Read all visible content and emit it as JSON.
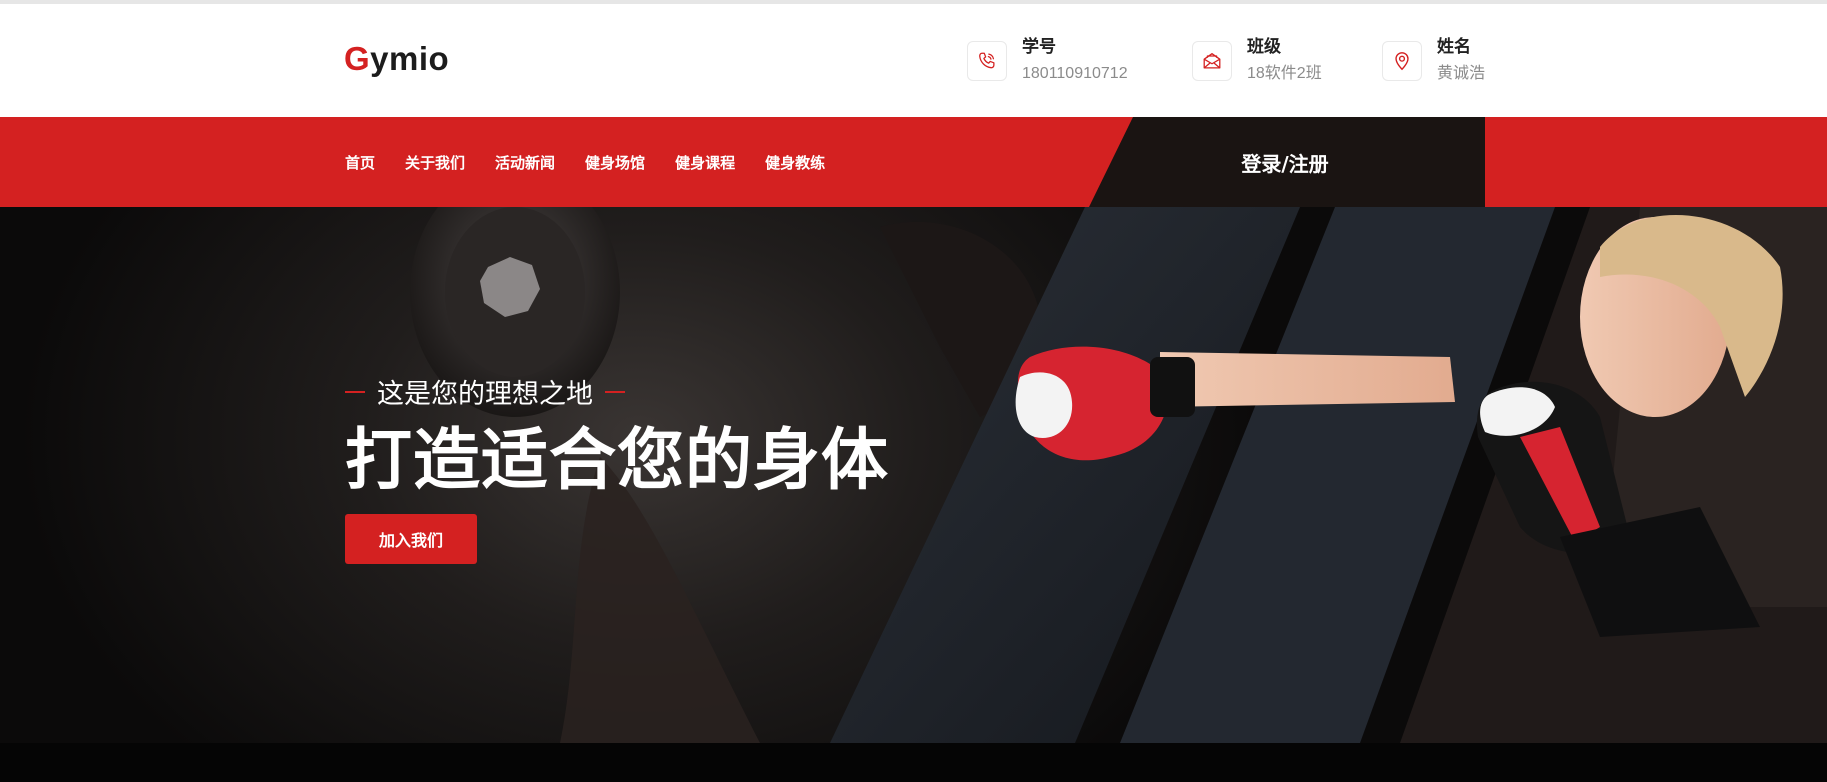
{
  "brand": {
    "first_letter": "G",
    "rest": "ymio"
  },
  "contact": [
    {
      "label": "学号",
      "value": "180110910712",
      "icon": "phone-icon"
    },
    {
      "label": "班级",
      "value": "18软件2班",
      "icon": "mail-icon"
    },
    {
      "label": "姓名",
      "value": "黄诚浩",
      "icon": "location-pin-icon"
    }
  ],
  "nav": {
    "items": [
      "首页",
      "关于我们",
      "活动新闻",
      "健身场馆",
      "健身课程",
      "健身教练"
    ],
    "login_label": "登录/注册"
  },
  "hero": {
    "subtitle": "这是您的理想之地",
    "title": "打造适合您的身体",
    "cta_label": "加入我们"
  },
  "colors": {
    "accent": "#d42121",
    "dark": "#1a1412",
    "hero_bg": "#0b0a0a"
  }
}
